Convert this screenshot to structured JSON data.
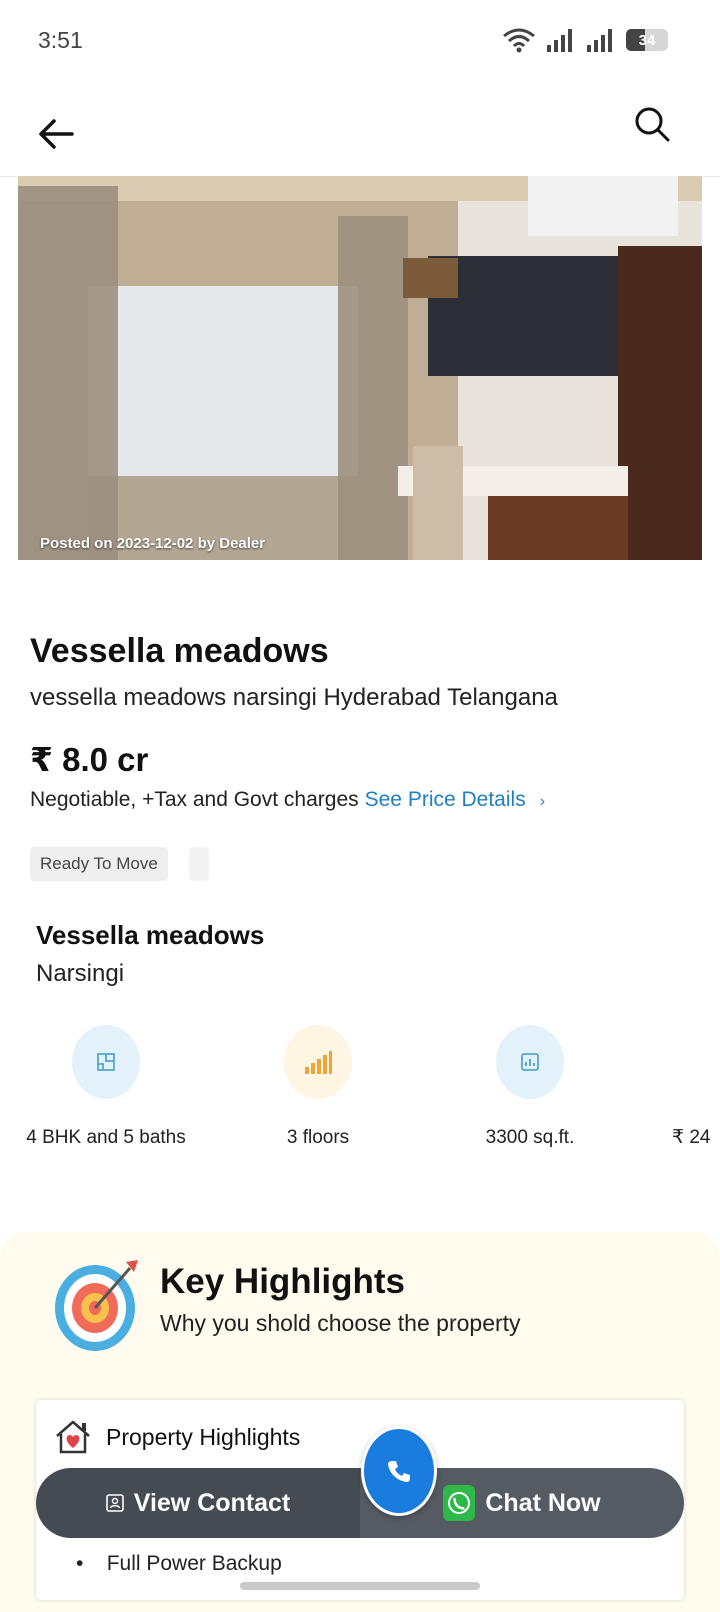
{
  "status_bar": {
    "time": "3:51",
    "battery": "34"
  },
  "hero": {
    "caption": "Posted on 2023-12-02 by Dealer"
  },
  "property": {
    "title": "Vessella meadows",
    "address": "vessella meadows narsingi Hyderabad Telangana",
    "price": "₹ 8.0 cr",
    "price_note": "Negotiable, +Tax and Govt charges",
    "price_link": "See Price Details",
    "tag": "Ready To Move"
  },
  "project": {
    "name": "Vessella meadows",
    "locality": "Narsingi"
  },
  "specs": [
    {
      "label": "4 BHK and 5 baths",
      "icon": "floorplan-icon",
      "color": "#e3f1fb"
    },
    {
      "label": "3 floors",
      "icon": "signal-bars-icon",
      "color": "#fff5e3"
    },
    {
      "label": "3300 sq.ft.",
      "icon": "area-chart-icon",
      "color": "#e3f1fb"
    },
    {
      "label": "₹ 24",
      "icon": "price-icon",
      "color": "#e3f1fb"
    }
  ],
  "highlights": {
    "title": "Key Highlights",
    "subtitle": "Why you shold choose the property",
    "card_title": "Property Highlights",
    "items": [
      "Full Power Backup"
    ]
  },
  "cta": {
    "view_contact": "View Contact",
    "chat_now": "Chat Now"
  },
  "colors": {
    "link": "#1f7fc4",
    "call_button": "#1a7cde",
    "cta_bg": "#454b53",
    "highlights_bg": "#fffbee"
  }
}
